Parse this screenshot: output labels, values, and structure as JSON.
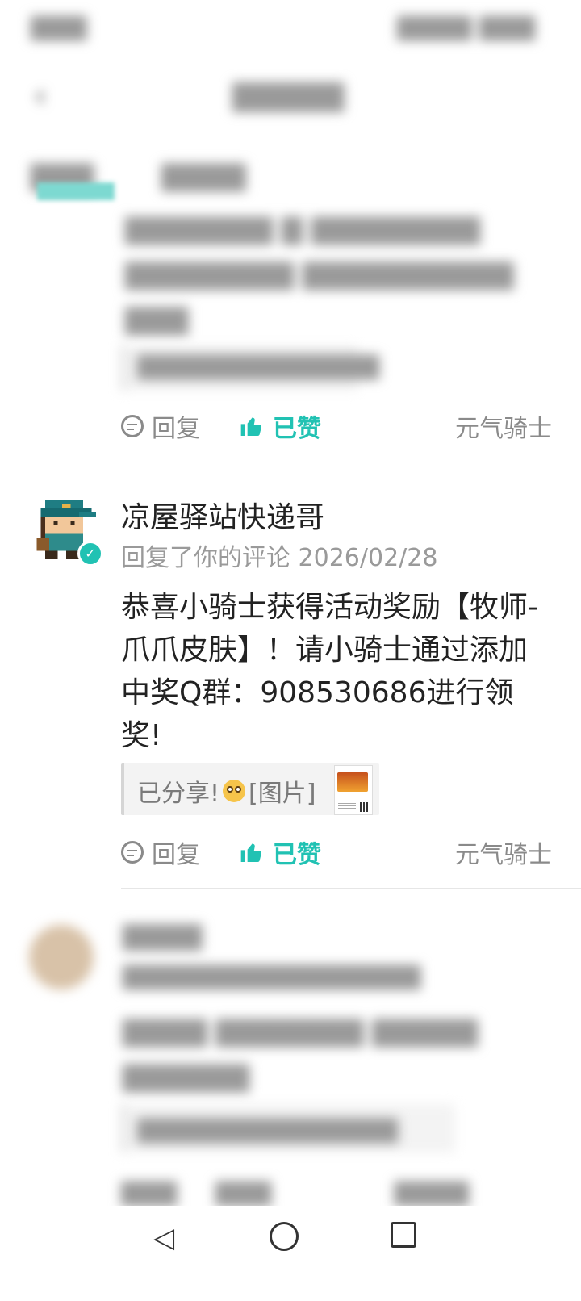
{
  "main_item": {
    "username": "凉屋驿站快递哥",
    "meta": "回复了你的评论 2026/02/28",
    "content": "恭喜小骑士获得活动奖励【牧师-爪爪皮肤】！请小骑士通过添加中奖Q群：908530686进行领奖!",
    "quote": {
      "prefix": "已分享!",
      "emoji_icon": "astonished-emoji-icon",
      "suffix": "[图片]"
    },
    "actions": {
      "reply": "回复",
      "liked": "已赞",
      "game": "元气骑士"
    }
  },
  "prev_item": {
    "actions": {
      "reply": "回复",
      "liked": "已赞",
      "game": "元气骑士"
    }
  },
  "colors": {
    "accent": "#21c2b3",
    "muted": "#8a8a8a",
    "text": "#222222"
  }
}
